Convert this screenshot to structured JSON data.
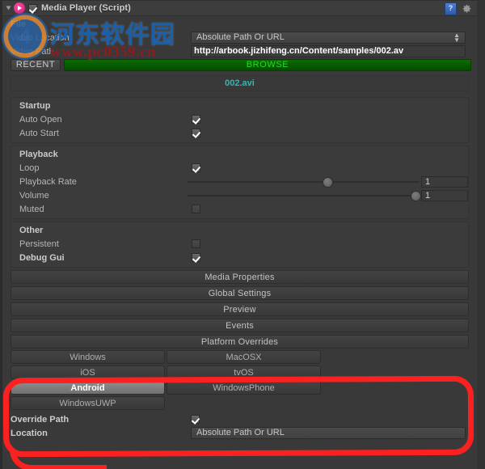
{
  "window": {
    "component_title": "Media Player (Script)",
    "enabled": true,
    "help_icon": "help-book-icon",
    "settings_icon": "gear-icon"
  },
  "file": {
    "section_title": "File",
    "video_location_label": "Video Location",
    "video_location_value": "Absolute Path Or URL",
    "video_path_label": "Video Path",
    "video_path_value": "http://arbook.jizhifeng.cn/Content/samples/002.av",
    "recent_label": "RECENT",
    "browse_label": "BROWSE",
    "filename": "002.avi",
    "browse_color": "#0c6b04",
    "browse_text_color": "#20e020",
    "filename_color": "#2fb9b3"
  },
  "startup": {
    "title": "Startup",
    "rows": [
      {
        "label": "Auto Open",
        "checked": true
      },
      {
        "label": "Auto Start",
        "checked": true
      }
    ]
  },
  "playback": {
    "title": "Playback",
    "loop_label": "Loop",
    "loop_checked": true,
    "playback_rate_label": "Playback Rate",
    "playback_rate_value": "1",
    "playback_rate_percent": 60,
    "volume_label": "Volume",
    "volume_value": "1",
    "volume_percent": 98,
    "muted_label": "Muted",
    "muted_checked": false
  },
  "other": {
    "title": "Other",
    "persistent_label": "Persistent",
    "persistent_checked": false,
    "debug_gui_label": "Debug Gui",
    "debug_gui_checked": true
  },
  "buttons": {
    "media_properties": "Media Properties",
    "global_settings": "Global Settings",
    "preview": "Preview",
    "events": "Events"
  },
  "platform_overrides": {
    "header": "Platform Overrides",
    "selected": "Android",
    "items": [
      {
        "label": "Windows",
        "selected": false
      },
      {
        "label": "MacOSX",
        "selected": false
      },
      {
        "label": "iOS",
        "selected": false
      },
      {
        "label": "tvOS",
        "selected": false
      },
      {
        "label": "Android",
        "selected": true
      },
      {
        "label": "WindowsPhone",
        "selected": false
      },
      {
        "label": "WindowsUWP",
        "selected": false
      }
    ]
  },
  "override": {
    "path_label": "Override Path",
    "path_checked": true,
    "location_label": "Location",
    "location_value": "Absolute Path Or URL"
  },
  "annotation": {
    "color": "#fb2121",
    "shape": "hand-drawn-red-outline"
  },
  "watermark": {
    "site_name": "河东软件园",
    "url": "www.pc0359.cn",
    "logo_mark": "4",
    "name_color": "#1b5fa8",
    "url_color": "#8d1c20"
  }
}
